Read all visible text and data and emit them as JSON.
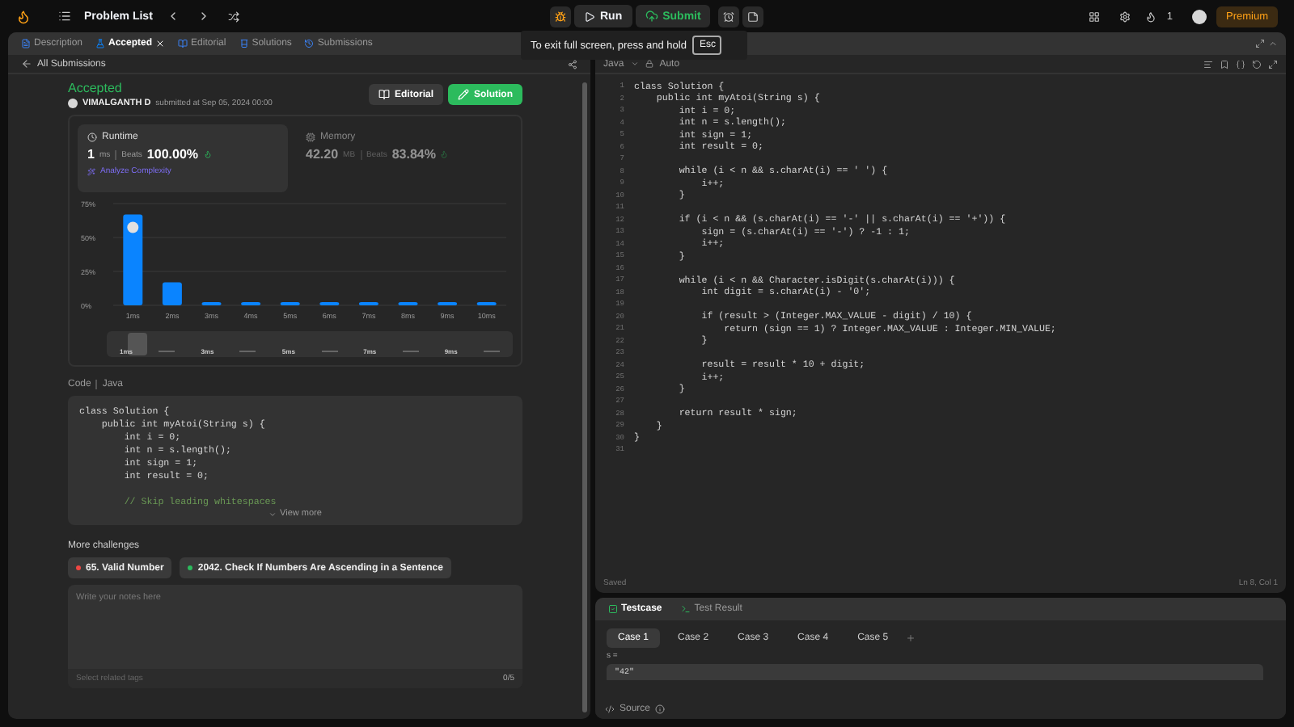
{
  "top_bar": {
    "problem_list": "Problem List",
    "run": "Run",
    "submit": "Submit",
    "streak": "1",
    "premium": "Premium"
  },
  "fullscreen_toast": {
    "text": "To exit full screen, press and hold",
    "key": "Esc"
  },
  "left_tabs": [
    {
      "label": "Description",
      "selected": false,
      "closable": false
    },
    {
      "label": "Accepted",
      "selected": true,
      "closable": true
    },
    {
      "label": "Editorial",
      "selected": false,
      "closable": false
    },
    {
      "label": "Solutions",
      "selected": false,
      "closable": false
    },
    {
      "label": "Submissions",
      "selected": false,
      "closable": false
    }
  ],
  "submission": {
    "back": "All Submissions",
    "status": "Accepted",
    "user": "VIMALGANTH D",
    "submitted": "submitted at Sep 05, 2024 00:00",
    "buttons": [
      {
        "label": "Editorial",
        "kind": "secondary"
      },
      {
        "label": "Solution",
        "kind": "primary"
      }
    ],
    "metrics": [
      {
        "title": "Runtime",
        "value": "1",
        "unit": "ms",
        "beats_label": "Beats",
        "beats": "100.00%",
        "selected": true,
        "link": "Analyze Complexity"
      },
      {
        "title": "Memory",
        "value": "42.20",
        "unit": "MB",
        "beats_label": "Beats",
        "beats": "83.84%",
        "selected": false
      }
    ],
    "chart_data": {
      "type": "bar",
      "categories": [
        "1ms",
        "2ms",
        "3ms",
        "4ms",
        "5ms",
        "6ms",
        "7ms",
        "8ms",
        "9ms",
        "10ms"
      ],
      "values": [
        67,
        17,
        2,
        2,
        2,
        2,
        2,
        2,
        2,
        2
      ],
      "ylim": [
        0,
        75
      ],
      "yticks": [
        {
          "value": 0,
          "label": "0%"
        },
        {
          "value": 25,
          "label": "25%"
        },
        {
          "value": 50,
          "label": "50%"
        },
        {
          "value": 75,
          "label": "75%"
        }
      ]
    },
    "overview_labels": [
      "1ms",
      "3ms",
      "5ms",
      "7ms",
      "9ms"
    ]
  },
  "code_preview": {
    "label": "Code",
    "language": "Java",
    "lines": [
      {
        "text": "class Solution {",
        "kind": "code"
      },
      {
        "text": "    public int myAtoi(String s) {",
        "kind": "code"
      },
      {
        "text": "        int i = 0;",
        "kind": "code"
      },
      {
        "text": "        int n = s.length();",
        "kind": "code"
      },
      {
        "text": "        int sign = 1;",
        "kind": "code"
      },
      {
        "text": "        int result = 0;",
        "kind": "code"
      },
      {
        "text": "        // Skip leading whitespaces",
        "kind": "comment"
      }
    ],
    "view_more": "View more"
  },
  "more_challenges": {
    "title": "More challenges",
    "items": [
      {
        "label": "65. Valid Number",
        "color": "#ef4743"
      },
      {
        "label": "2042. Check If Numbers Are Ascending in a Sentence",
        "color": "#2cbb5d"
      }
    ]
  },
  "notes": {
    "placeholder": "Write your notes here",
    "tags_placeholder": "Select related tags",
    "count": "0/5"
  },
  "editor": {
    "language": "Java",
    "mode": "Auto",
    "status": "Saved",
    "cursor": "Ln 8, Col 1",
    "lines": [
      {
        "number": "1",
        "code": "class Solution {"
      },
      {
        "number": "2",
        "code": "    public int myAtoi(String s) {"
      },
      {
        "number": "3",
        "code": "        int i = 0;"
      },
      {
        "number": "4",
        "code": "        int n = s.length();"
      },
      {
        "number": "5",
        "code": "        int sign = 1;"
      },
      {
        "number": "6",
        "code": "        int result = 0;"
      },
      {
        "number": "7"
      },
      {
        "number": "8",
        "code": "        while (i < n && s.charAt(i) == ' ') {"
      },
      {
        "number": "9",
        "code": "            i++;"
      },
      {
        "number": "10",
        "code": "        }"
      },
      {
        "number": "11"
      },
      {
        "number": "12",
        "code": "        if (i < n && (s.charAt(i) == '-' || s.charAt(i) == '+')) {"
      },
      {
        "number": "13",
        "code": "            sign = (s.charAt(i) == '-') ? -1 : 1;"
      },
      {
        "number": "14",
        "code": "            i++;"
      },
      {
        "number": "15",
        "code": "        }"
      },
      {
        "number": "16"
      },
      {
        "number": "17",
        "code": "        while (i < n && Character.isDigit(s.charAt(i))) {"
      },
      {
        "number": "18",
        "code": "            int digit = s.charAt(i) - '0';"
      },
      {
        "number": "19"
      },
      {
        "number": "20",
        "code": "            if (result > (Integer.MAX_VALUE - digit) / 10) {"
      },
      {
        "number": "21",
        "code": "                return (sign == 1) ? Integer.MAX_VALUE : Integer.MIN_VALUE;"
      },
      {
        "number": "22",
        "code": "            }"
      },
      {
        "number": "23"
      },
      {
        "number": "24",
        "code": "            result = result * 10 + digit;"
      },
      {
        "number": "25",
        "code": "            i++;"
      },
      {
        "number": "26",
        "code": "        }"
      },
      {
        "number": "27"
      },
      {
        "number": "28",
        "code": "        return result * sign;"
      },
      {
        "number": "29",
        "code": "    }"
      },
      {
        "number": "30",
        "code": "}"
      },
      {
        "number": "31"
      }
    ]
  },
  "console": {
    "tabs": [
      {
        "label": "Testcase",
        "selected": true
      },
      {
        "label": "Test Result",
        "selected": false
      }
    ],
    "cases": [
      {
        "label": "Case 1",
        "selected": true
      },
      {
        "label": "Case 2",
        "selected": false
      },
      {
        "label": "Case 3",
        "selected": false
      },
      {
        "label": "Case 4",
        "selected": false
      },
      {
        "label": "Case 5",
        "selected": false
      }
    ],
    "param": "s =",
    "value": "\"42\"",
    "source": "Source"
  }
}
